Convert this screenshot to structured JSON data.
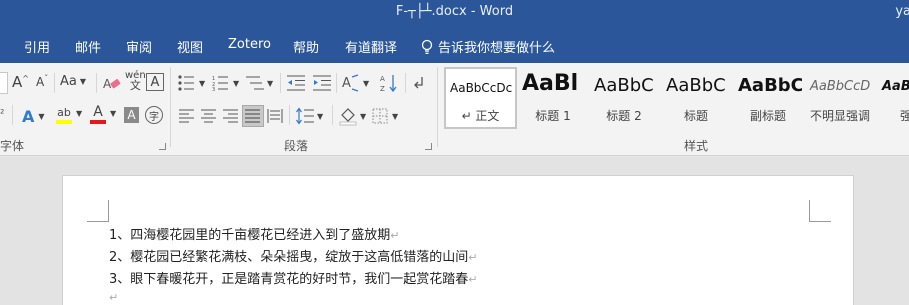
{
  "window": {
    "title": "F-┬├┴.docx  -  Word",
    "user": "ya"
  },
  "menu": {
    "tabs": [
      {
        "label": "引用"
      },
      {
        "label": "邮件"
      },
      {
        "label": "审阅"
      },
      {
        "label": "视图"
      },
      {
        "label": "Zotero"
      },
      {
        "label": "帮助"
      },
      {
        "label": "有道翻译"
      }
    ],
    "tell_me": "告诉我你想要做什么"
  },
  "ribbon": {
    "font_group": {
      "label": "字体",
      "grow_glyph": "A",
      "shrink_glyph": "A",
      "case_glyph": "Aa",
      "phonetic_glyph": "wén",
      "border_glyph": "A",
      "text_effect_glyph": "A",
      "highlight_glyph": "ab",
      "font_color_glyph": "A",
      "shading_glyph": "A",
      "enclose_glyph": "字"
    },
    "paragraph_group": {
      "label": "段落"
    },
    "styles_group": {
      "label": "样式",
      "styles": [
        {
          "sample": "AaBbCcDc",
          "name": "↵ 正文",
          "selected": true
        },
        {
          "sample": "AaBl",
          "name": "标题 1"
        },
        {
          "sample": "AaBbC",
          "name": "标题 2"
        },
        {
          "sample": "AaBbC",
          "name": "标题"
        },
        {
          "sample": "AaBbC",
          "name": "副标题"
        },
        {
          "sample": "AaBbCcD",
          "name": "不明显强调"
        },
        {
          "sample": "AaBb",
          "name": "强"
        }
      ]
    }
  },
  "document": {
    "lines": [
      {
        "text": "1、四海樱花园里的千亩樱花已经进入到了盛放期",
        "mark": "↵"
      },
      {
        "text": "2、樱花园已经繁花满枝、朵朵摇曳，绽放于这高低错落的山间",
        "mark": "↵"
      },
      {
        "text": "3、眼下春暖花开，正是踏青赏花的好时节，我们一起赏花踏春",
        "mark": "↵"
      },
      {
        "text": "",
        "mark": "↵"
      }
    ]
  }
}
